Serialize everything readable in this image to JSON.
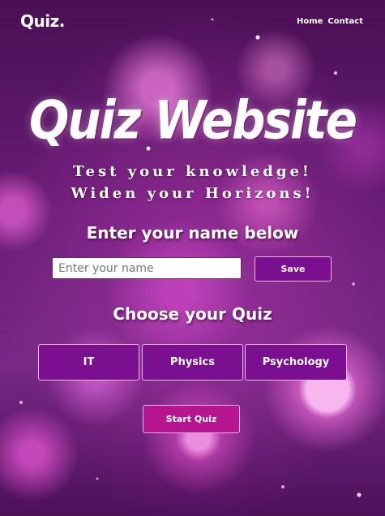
{
  "nav": {
    "logo": "Quiz.",
    "links": [
      {
        "label": "Home"
      },
      {
        "label": "Contact"
      }
    ]
  },
  "hero": {
    "title": "Quiz Website",
    "tagline_line1": "Test your knowledge!",
    "tagline_line2": "Widen your Horizons!"
  },
  "name_section": {
    "heading": "Enter your name below",
    "input_placeholder": "Enter your name",
    "input_value": "",
    "save_label": "Save"
  },
  "quiz_section": {
    "heading": "Choose your Quiz",
    "options": [
      {
        "label": "IT"
      },
      {
        "label": "Physics"
      },
      {
        "label": "Psychology"
      }
    ]
  },
  "start_button": {
    "label": "Start Quiz"
  },
  "colors": {
    "button_purple": "#7a0f8f",
    "start_button_magenta": "#b5168f",
    "background_purple": "#6b1f78",
    "text": "#ffffff"
  }
}
